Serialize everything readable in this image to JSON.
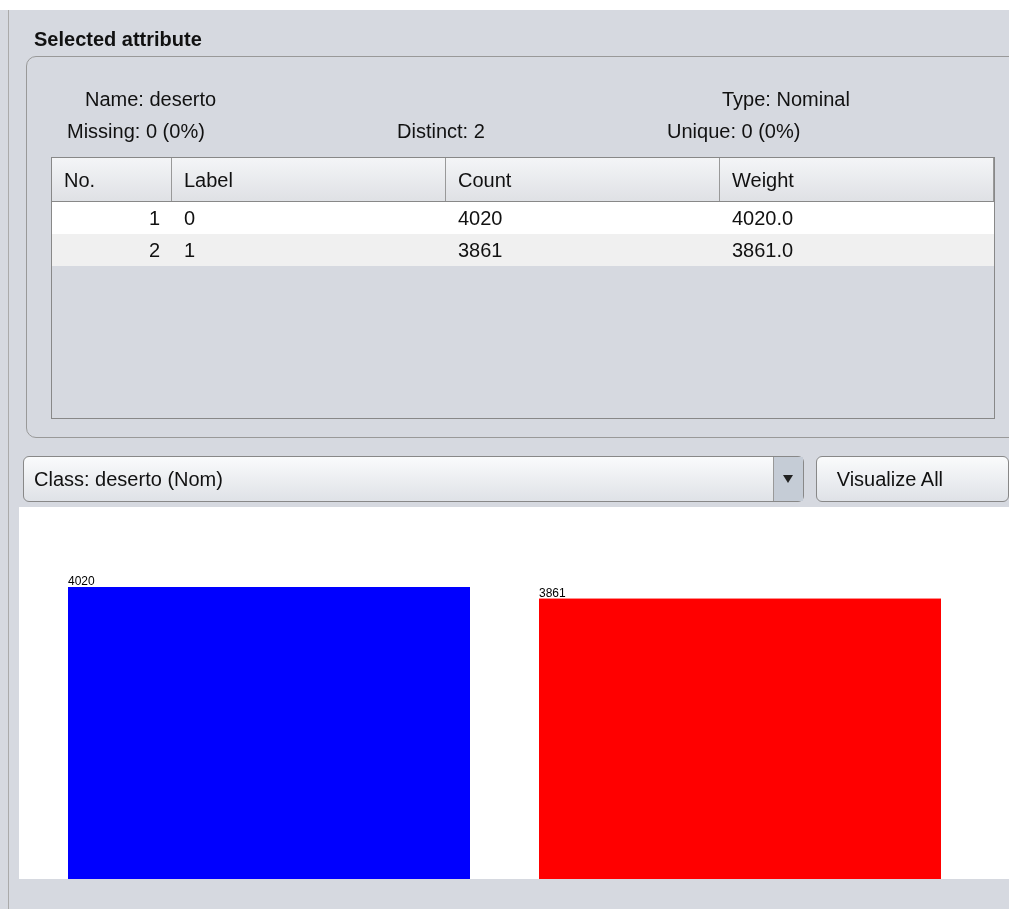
{
  "panel": {
    "title": "Selected attribute"
  },
  "summary": [
    {
      "label": "Name:",
      "value": "deserto"
    },
    {
      "label": "Type:",
      "value": "Nominal"
    },
    {
      "label": "Missing:",
      "value": "0 (0%)"
    },
    {
      "label": "Distinct:",
      "value": "2"
    },
    {
      "label": "Unique:",
      "value": "0 (0%)"
    }
  ],
  "table": {
    "columns": [
      "No.",
      "Label",
      "Count",
      "Weight"
    ],
    "rows": [
      [
        "1",
        "0",
        "4020",
        "4020.0"
      ],
      [
        "2",
        "1",
        "3861",
        "3861.0"
      ]
    ]
  },
  "class_select": {
    "value": "Class: deserto (Nom)"
  },
  "buttons": [
    "Visualize All"
  ],
  "chart_data": {
    "type": "bar",
    "data_labels": true,
    "stacked": true,
    "categories": [
      null,
      null
    ],
    "series": [
      {
        "color": "#0000ff",
        "values": [
          4020,
          null
        ]
      },
      {
        "color": "#ff0000",
        "values": [
          null,
          3861
        ]
      }
    ]
  }
}
